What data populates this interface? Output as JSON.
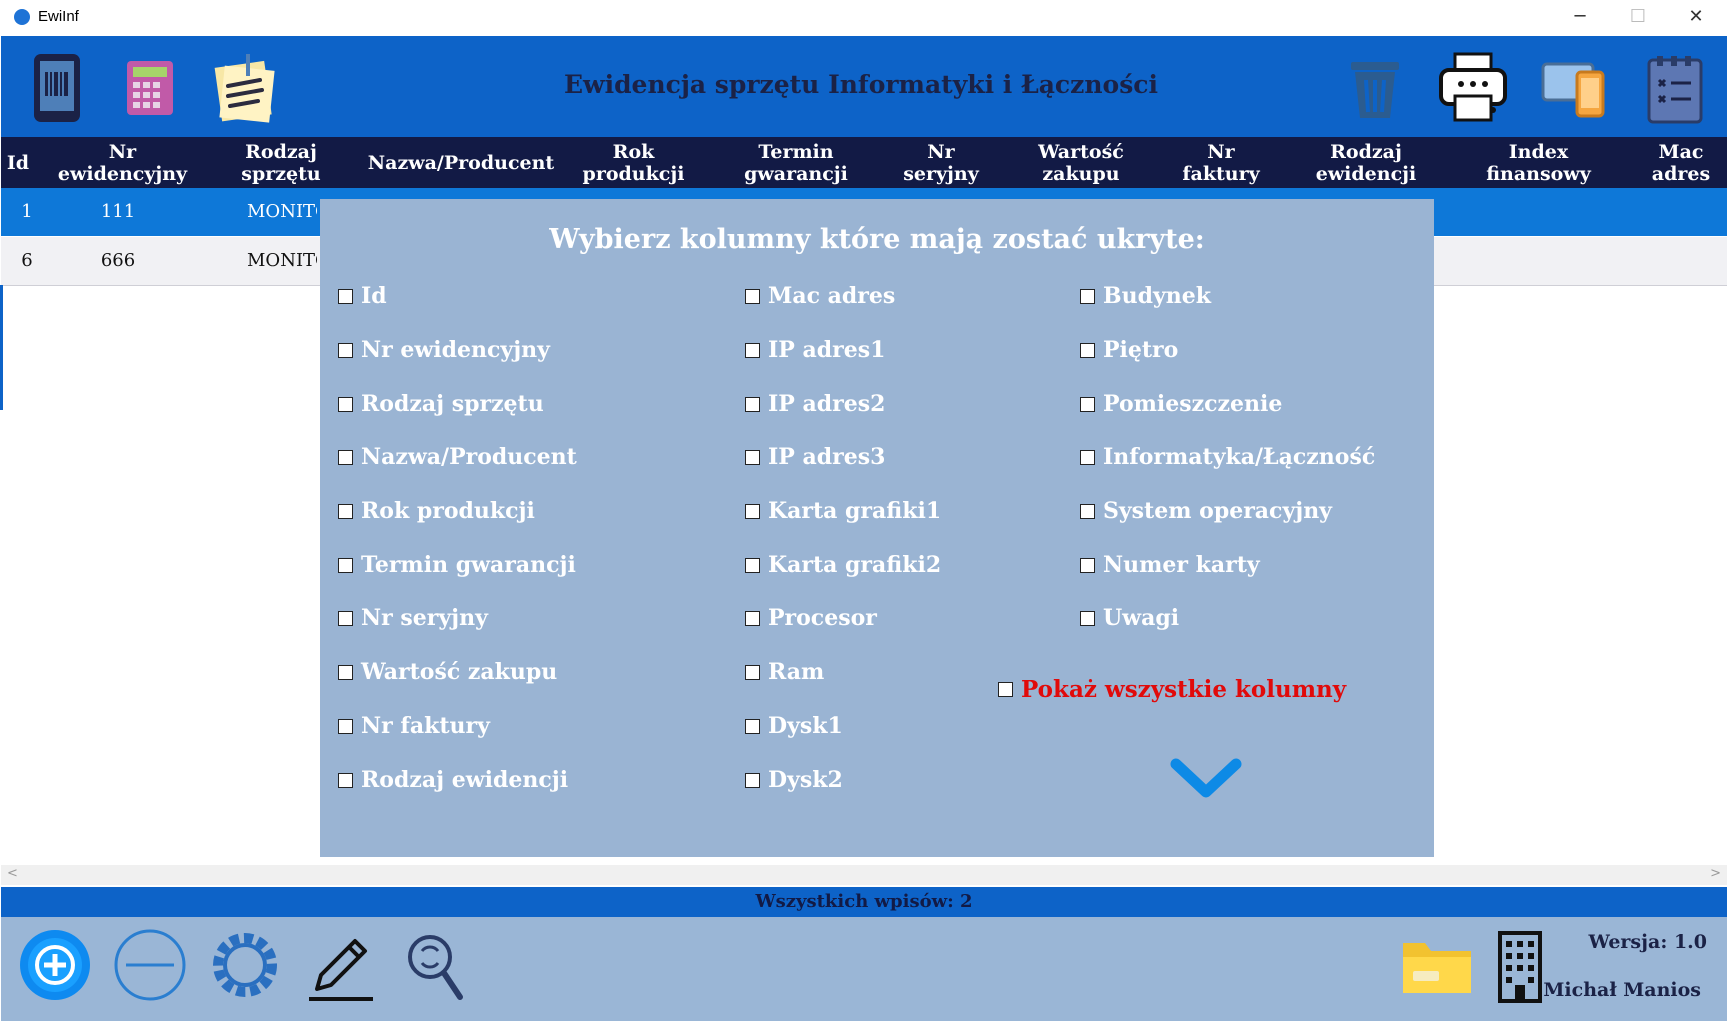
{
  "window": {
    "title": "EwiInf",
    "minimize": "─",
    "maximize": "☐",
    "close": "✕"
  },
  "toolbar": {
    "title": "Ewidencja sprzętu Informatyki i Łączności",
    "left_icons": [
      "phone-barcode-icon",
      "calculator-icon",
      "notes-icon"
    ],
    "right_icons": [
      "trash-icon",
      "printer-icon",
      "devices-icon",
      "checklist-icon"
    ]
  },
  "table": {
    "columns": [
      "Id",
      "Nr\newidencyjny",
      "Rodzaj\nsprzętu",
      "Nazwa/Producent",
      "Rok\nprodukcji",
      "Termin\ngwarancji",
      "Nr\nseryjny",
      "Wartość\nzakupu",
      "Nr\nfaktury",
      "Rodzaj\newidencji",
      "Index\nfinansowy",
      "Mac\nadres"
    ],
    "rows": [
      {
        "id": "1",
        "nr": "111",
        "rodzaj": "MONITO"
      },
      {
        "id": "6",
        "nr": "666",
        "rodzaj": "MONITO"
      }
    ]
  },
  "dialog": {
    "title": "Wybierz kolumny które mają zostać ukryte:",
    "col1": [
      "Id",
      "Nr ewidencyjny",
      "Rodzaj sprzętu",
      "Nazwa/Producent",
      "Rok produkcji",
      "Termin gwarancji",
      "Nr seryjny",
      "Wartość zakupu",
      "Nr faktury",
      "Rodzaj ewidencji"
    ],
    "col2": [
      "Mac adres",
      "IP adres1",
      "IP adres2",
      "IP adres3",
      "Karta grafiki1",
      "Karta grafiki2",
      "Procesor",
      "Ram",
      "Dysk1",
      "Dysk2"
    ],
    "col3": [
      "Budynek",
      "Piętro",
      "Pomieszczenie",
      "Informatyka/Łączność",
      "System operacyjny",
      "Numer karty",
      "Uwagi"
    ],
    "show_all": "Pokaż wszystkie kolumny",
    "show_all_color": "#e10a0a"
  },
  "scroll": {
    "left": "<",
    "right": ">"
  },
  "status": {
    "text": "Wszystkich wpisów: 2"
  },
  "footer": {
    "version": "Wersja: 1.0",
    "author": "Michał Manios",
    "icons": [
      "add-icon",
      "remove-icon",
      "settings-gear-icon",
      "edit-pen-icon",
      "search-refresh-icon",
      "folder-icon",
      "building-icon"
    ]
  },
  "colors": {
    "primary": "#0d63c8",
    "header": "#121a45",
    "dialog": "#9ab4d3",
    "selected_row": "#0e78d8"
  }
}
